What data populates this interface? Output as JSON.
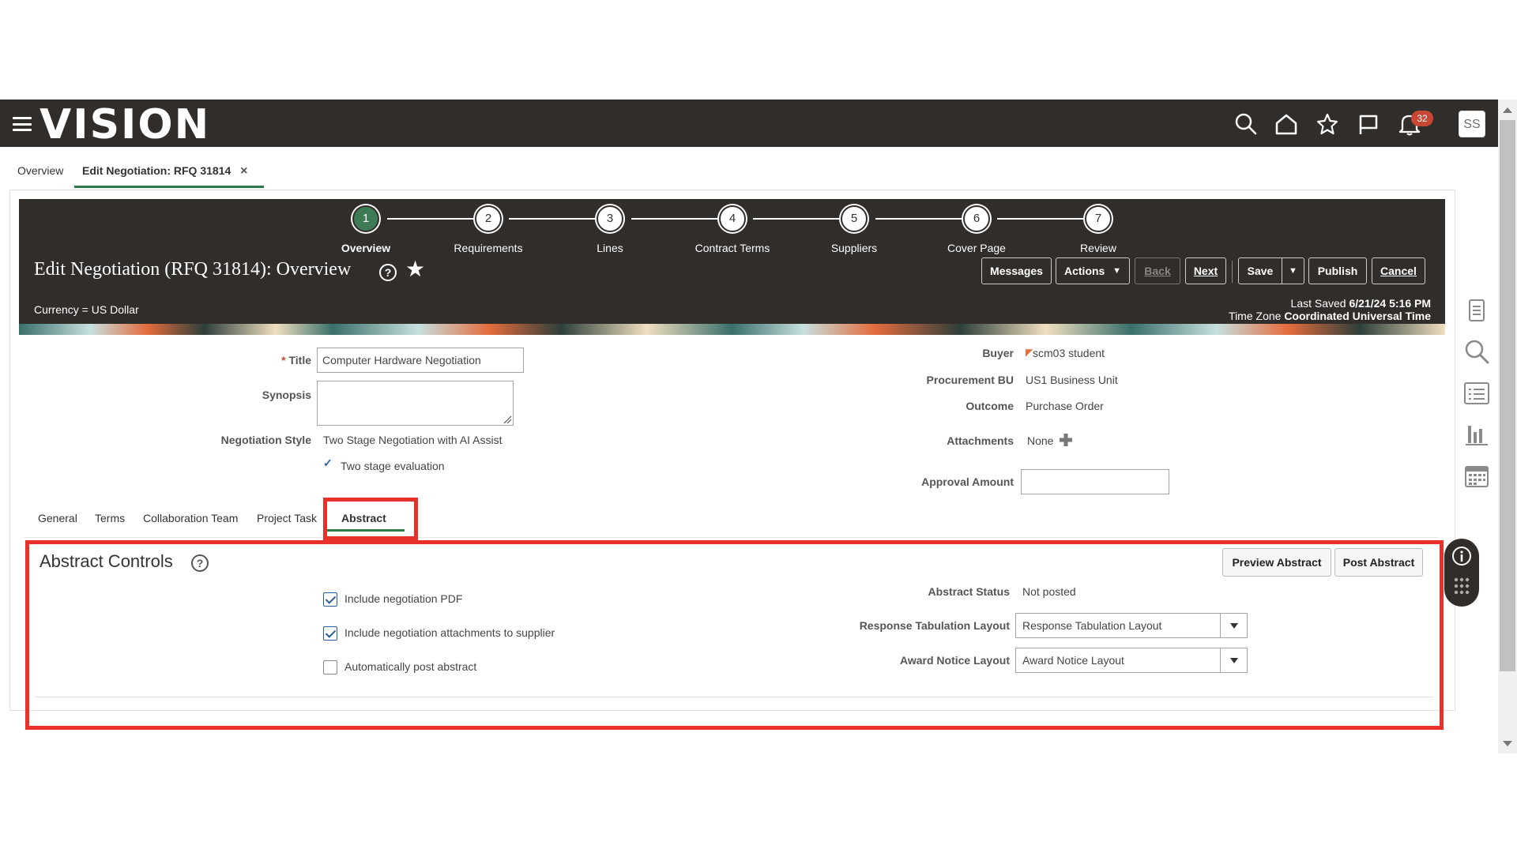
{
  "app": {
    "logo": "VISION",
    "notification_count": "32",
    "user_initials": "SS"
  },
  "page_tabs": [
    {
      "label": "Overview"
    },
    {
      "label": "Edit Negotiation: RFQ 31814",
      "close": "×"
    }
  ],
  "train": {
    "steps": [
      {
        "number": "1",
        "label": "Overview"
      },
      {
        "number": "2",
        "label": "Requirements"
      },
      {
        "number": "3",
        "label": "Lines"
      },
      {
        "number": "4",
        "label": "Contract Terms"
      },
      {
        "number": "5",
        "label": "Suppliers"
      },
      {
        "number": "6",
        "label": "Cover Page"
      },
      {
        "number": "7",
        "label": "Review"
      }
    ],
    "title": "Edit Negotiation (RFQ 31814): Overview",
    "help": "?",
    "currency": "Currency = US Dollar",
    "last_saved_label": "Last Saved",
    "last_saved_value": "6/21/24 5:16 PM",
    "time_zone_label": "Time Zone",
    "time_zone_value": "Coordinated Universal Time",
    "buttons": {
      "messages": "Messages",
      "actions": "Actions",
      "back": "Back",
      "next": "Next",
      "save": "Save",
      "publish": "Publish",
      "cancel": "Cancel"
    }
  },
  "form": {
    "title_required": "*",
    "title_label": "Title",
    "title_value": "Computer Hardware Negotiation",
    "synopsis_label": "Synopsis",
    "synopsis_value": "",
    "negotiation_style_label": "Negotiation Style",
    "negotiation_style_value": "Two Stage Negotiation with AI Assist",
    "two_stage_check": "✓",
    "two_stage_label": "Two stage evaluation",
    "buyer_label": "Buyer",
    "buyer_value": "scm03 student",
    "procurement_bu_label": "Procurement BU",
    "procurement_bu_value": "US1 Business Unit",
    "outcome_label": "Outcome",
    "outcome_value": "Purchase Order",
    "attachments_label": "Attachments",
    "attachments_value": "None",
    "approval_amount_label": "Approval Amount",
    "approval_amount_value": ""
  },
  "sub_tabs": [
    {
      "label": "General"
    },
    {
      "label": "Terms"
    },
    {
      "label": "Collaboration Team"
    },
    {
      "label": "Project Task"
    },
    {
      "label": "Abstract"
    }
  ],
  "abstract": {
    "title": "Abstract Controls",
    "help": "?",
    "preview_button": "Preview Abstract",
    "post_button": "Post Abstract",
    "include_pdf_label": "Include negotiation PDF",
    "include_pdf_checked": true,
    "include_attachments_label": "Include negotiation attachments to supplier",
    "include_attachments_checked": true,
    "auto_post_label": "Automatically post abstract",
    "auto_post_checked": false,
    "status_label": "Abstract Status",
    "status_value": "Not posted",
    "response_layout_label": "Response Tabulation Layout",
    "response_layout_value": "Response Tabulation Layout",
    "award_layout_label": "Award Notice Layout",
    "award_layout_value": "Award Notice Layout"
  },
  "colors": {
    "header_bg": "#312d2a",
    "active_step": "#3d7b54",
    "tab_underline": "#2c7a4a",
    "highlight": "#e8312b",
    "badge": "#c74634"
  }
}
